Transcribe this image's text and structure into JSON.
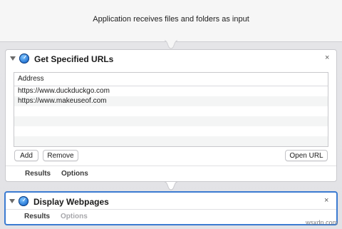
{
  "workflow": {
    "input_description": "Application receives files and folders as input"
  },
  "actions": [
    {
      "title": "Get Specified URLs",
      "close_label": "×",
      "table": {
        "column_header": "Address",
        "rows": [
          "https://www.duckduckgo.com",
          "https://www.makeuseof.com",
          "",
          "",
          "",
          ""
        ]
      },
      "buttons": {
        "add": "Add",
        "remove": "Remove",
        "open_url": "Open URL"
      },
      "tabs": [
        "Results",
        "Options"
      ]
    },
    {
      "title": "Display Webpages",
      "close_label": "×",
      "tabs": [
        "Results",
        "Options"
      ]
    }
  ],
  "watermark": "wsxdn.com",
  "colors": {
    "selection_border": "#3b7bd1",
    "inactive_tab": "#a7a7ab"
  },
  "icons": {
    "action_icon": "safari-compass-icon",
    "disclosure": "disclosure-triangle-icon",
    "close": "close-icon"
  }
}
